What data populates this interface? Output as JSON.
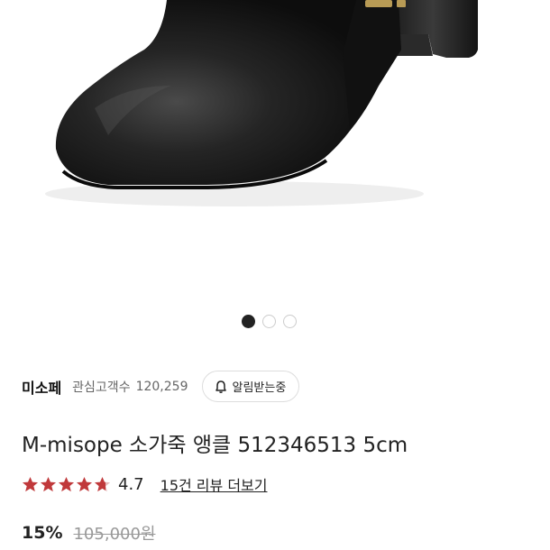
{
  "product_image": {
    "icon": "ankle-boot-photo"
  },
  "carousel": {
    "active_index": 1,
    "total": 3
  },
  "seller": {
    "name": "미소페",
    "followers_label": "관심고객수",
    "followers_count": "120,259",
    "notify_label": "알림받는중",
    "notify_icon": "bell-icon"
  },
  "product": {
    "title": "M-misope 소가죽 앵클 512346513 5cm"
  },
  "rating": {
    "value": "4.7",
    "star_color": "#c0393b",
    "review_link": "15건 리뷰 더보기"
  },
  "price": {
    "discount": "15%",
    "original": "105,000원"
  }
}
